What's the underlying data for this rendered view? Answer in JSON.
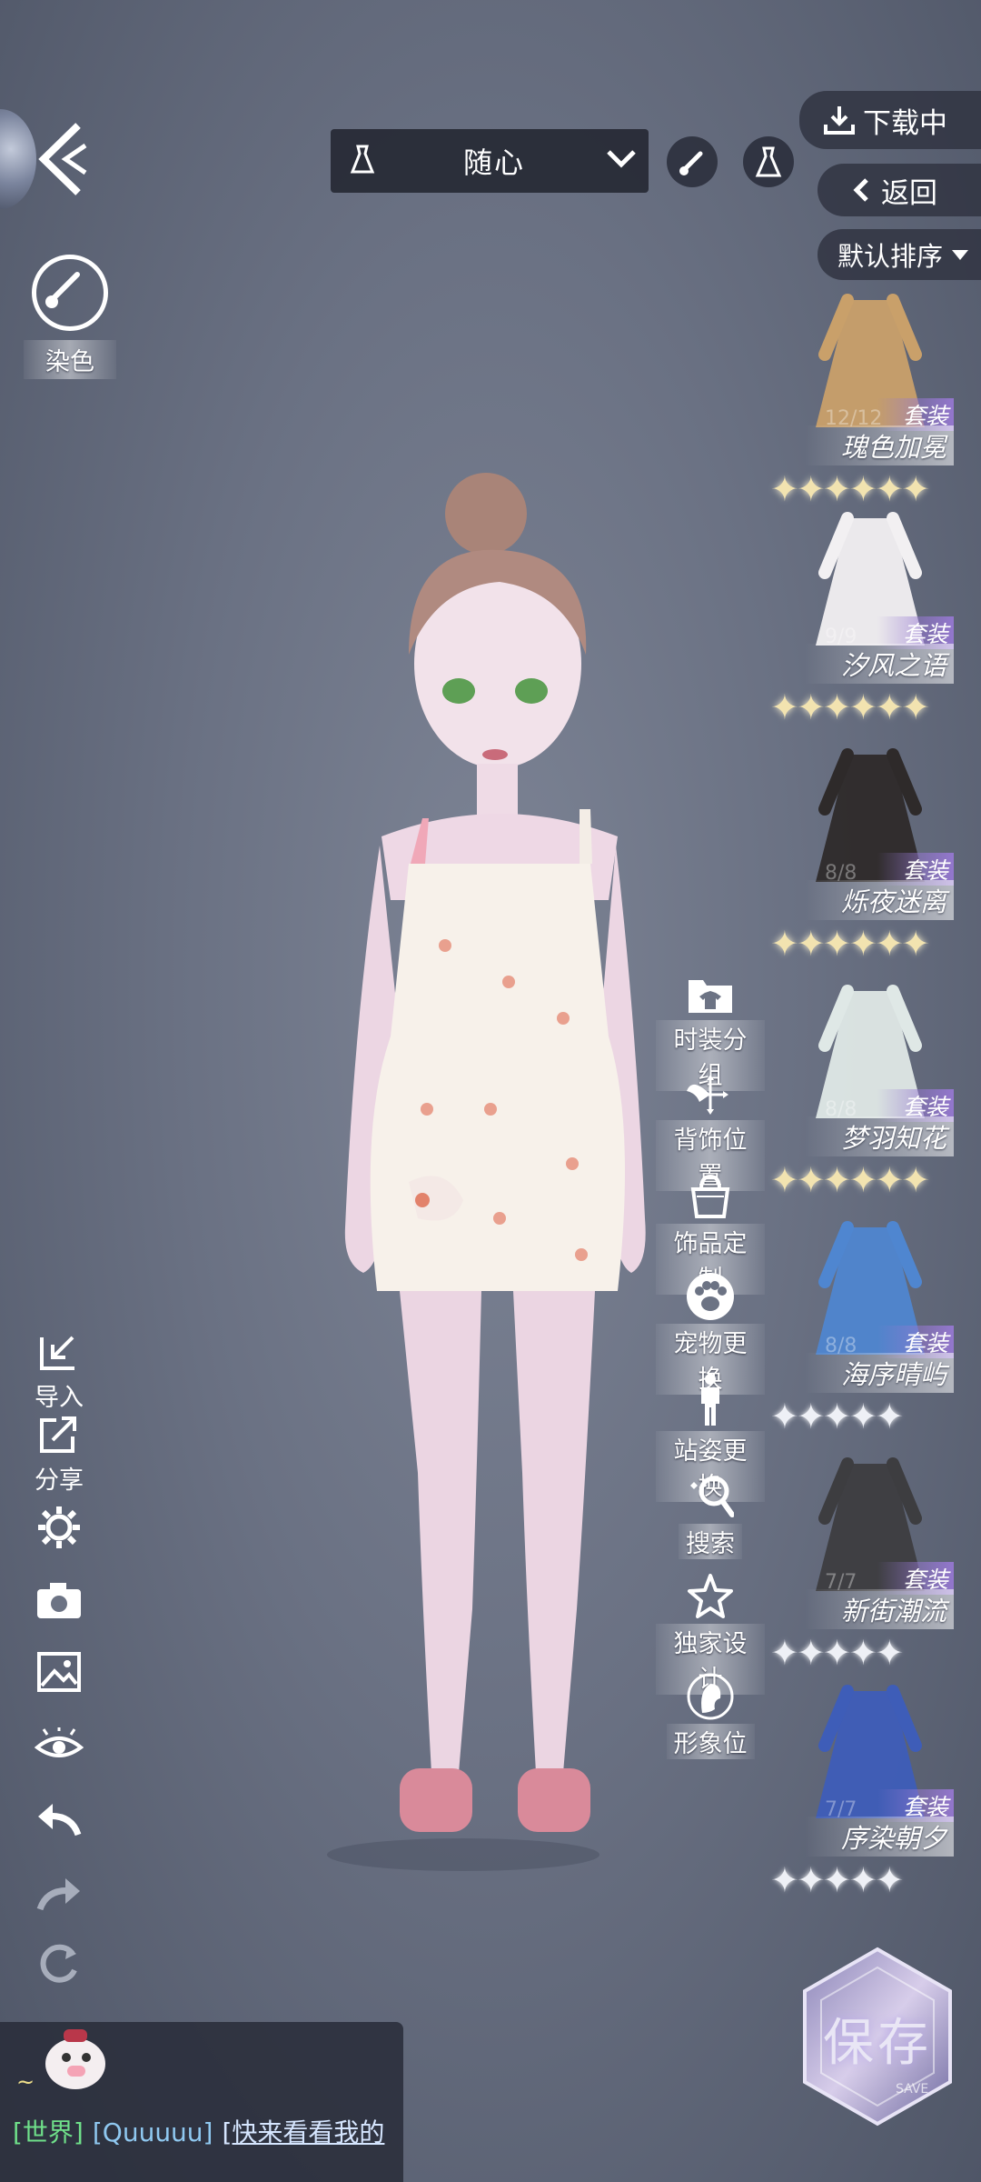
{
  "top": {
    "dropdown_value": "随心",
    "dye_label": "染色"
  },
  "right_top": {
    "download_label": "下载中",
    "return_label": "返回",
    "sort_label": "默认排序"
  },
  "outfits": [
    {
      "count": "12/12",
      "badge": "套装",
      "name": "瑰色加冕",
      "stars": "gold",
      "star_count": 6,
      "color": "#c9a06a"
    },
    {
      "count": "9/9",
      "badge": "套装",
      "name": "汐风之语",
      "stars": "gold",
      "star_count": 6,
      "color": "#f2f0f2"
    },
    {
      "count": "8/8",
      "badge": "套装",
      "name": "烁夜迷离",
      "stars": "gold",
      "star_count": 6,
      "color": "#2e2a2a"
    },
    {
      "count": "8/8",
      "badge": "套装",
      "name": "梦羽知花",
      "stars": "gold",
      "star_count": 6,
      "color": "#dfe8e6"
    },
    {
      "count": "8/8",
      "badge": "套装",
      "name": "海序晴屿",
      "stars": "white",
      "star_count": 5,
      "color": "#4f86d0"
    },
    {
      "count": "7/7",
      "badge": "套装",
      "name": "新街潮流",
      "stars": "white",
      "star_count": 5,
      "color": "#3d3d40"
    },
    {
      "count": "7/7",
      "badge": "套装",
      "name": "序染朝夕",
      "stars": "white",
      "star_count": 5,
      "color": "#3e5db8"
    }
  ],
  "mid_tools": [
    {
      "label": "时装分组",
      "icon": "folder-shirt-icon"
    },
    {
      "label": "背饰位置",
      "icon": "wings-move-icon"
    },
    {
      "label": "饰品定制",
      "icon": "bag-icon"
    },
    {
      "label": "宠物更换",
      "icon": "paw-icon"
    },
    {
      "label": "站姿更换",
      "icon": "standing-person-icon"
    },
    {
      "label": "搜索",
      "icon": "search-icon"
    },
    {
      "label": "独家设计",
      "icon": "star-icon"
    },
    {
      "label": "形象位",
      "icon": "portrait-icon"
    }
  ],
  "left_tools": {
    "import_label": "导入",
    "share_label": "分享"
  },
  "chat": {
    "channel": "[世界]",
    "user": "[Quuuuu]",
    "message": "[快来看看我的",
    "emote": "~"
  },
  "save": {
    "label": "保存",
    "sublabel": "SAVE"
  }
}
